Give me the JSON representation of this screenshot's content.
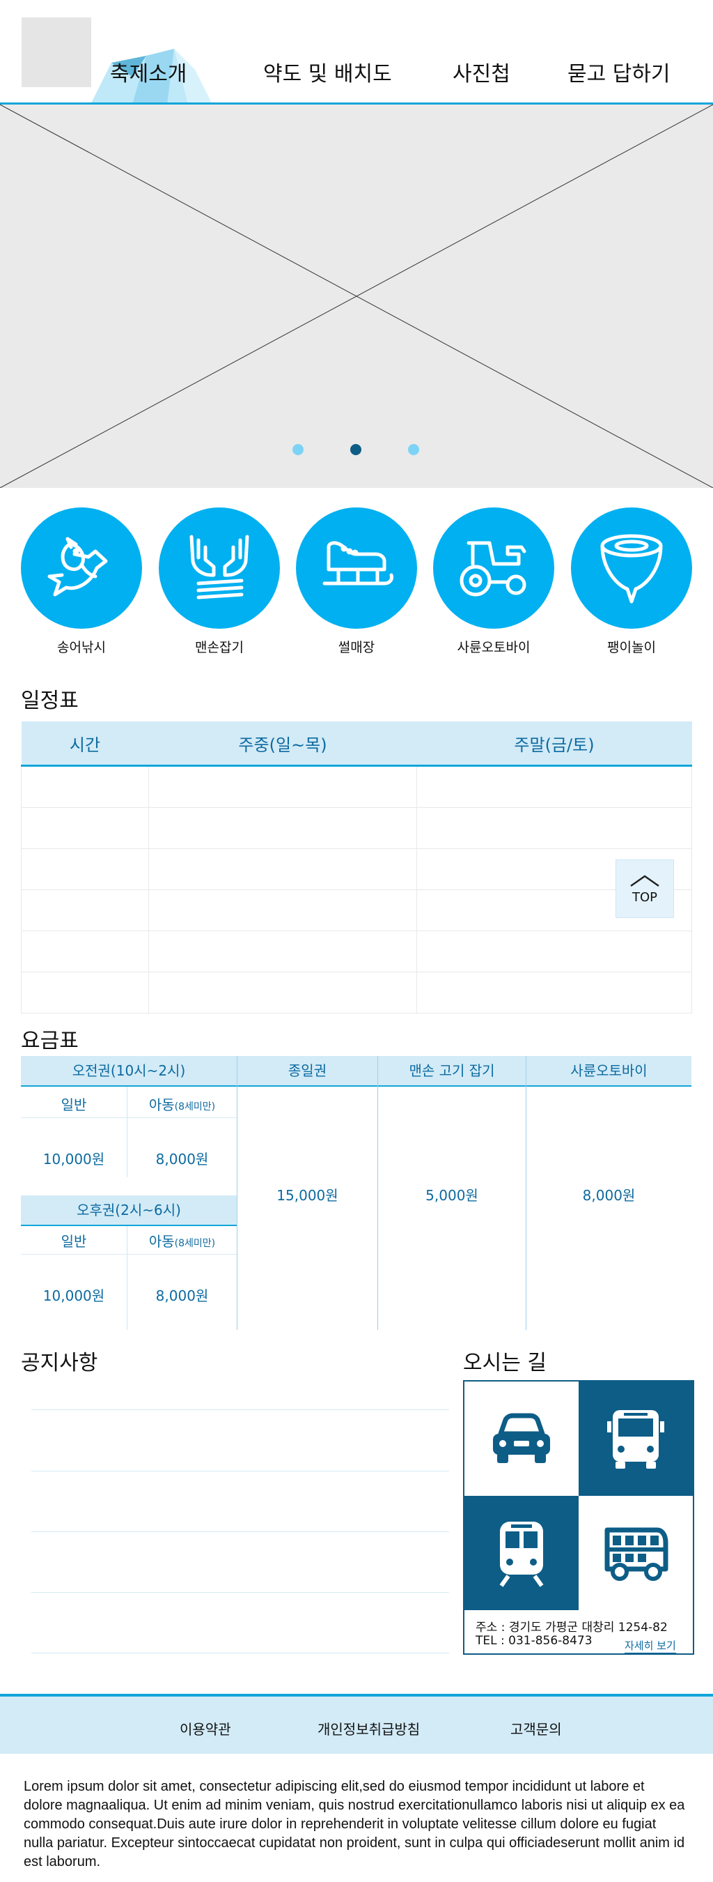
{
  "header": {
    "nav": [
      "축제소개",
      "약도 및 배치도",
      "사진첩",
      "묻고 답하기"
    ],
    "active_index": 0
  },
  "hero": {
    "slide_count": 3,
    "active_slide": 2
  },
  "activities": [
    {
      "label": "송어낚시",
      "icon": "fish-icon"
    },
    {
      "label": "맨손잡기",
      "icon": "hands-icon"
    },
    {
      "label": "썰매장",
      "icon": "sled-icon"
    },
    {
      "label": "사륜오토바이",
      "icon": "tractor-icon"
    },
    {
      "label": "팽이놀이",
      "icon": "spinning-top-icon"
    }
  ],
  "schedule": {
    "title": "일정표",
    "headers": [
      "시간",
      "주중(일~목)",
      "주말(금/토)"
    ]
  },
  "fees": {
    "title": "요금표",
    "morning": "오전권(10시~2시)",
    "afternoon": "오후권(2시~6시)",
    "adult": "일반",
    "child": "아동",
    "child_note": "(8세미만)",
    "adult_price": "10,000원",
    "child_price": "8,000원",
    "columns": [
      {
        "label": "종일권",
        "price": "15,000원"
      },
      {
        "label": "맨손 고기 잡기",
        "price": "5,000원"
      },
      {
        "label": "사륜오토바이",
        "price": "8,000원"
      }
    ]
  },
  "notices": {
    "title": "공지사항"
  },
  "directions": {
    "title": "오시는 길",
    "address": "주소 : 경기도 가평군 대창리 1254-82",
    "tel": "TEL : 031-856-8473",
    "more": "자세히 보기",
    "icons": [
      "car-icon",
      "bus-icon",
      "train-icon",
      "double-decker-bus-icon"
    ]
  },
  "top_button": "TOP",
  "footer": {
    "links": [
      "이용약관",
      "개인정보취급방침",
      "고객문의"
    ],
    "text": "Lorem ipsum dolor sit amet, consectetur adipiscing elit,sed do eiusmod tempor incididunt ut labore et dolore magnaaliqua. Ut enim ad minim veniam, quis nostrud exercitationullamco laboris nisi ut aliquip ex ea commodo consequat.Duis aute irure dolor in reprehenderit in voluptate velitesse cillum dolore eu fugiat nulla pariatur. Excepteur sintoccaecat cupidatat non proident, sunt in culpa qui officiadeserunt mollit anim id est laborum."
  },
  "colors": {
    "accent": "#00b0f0",
    "line": "#11a5d9",
    "dark": "#0d5d87",
    "light": "#d2ebf7"
  }
}
